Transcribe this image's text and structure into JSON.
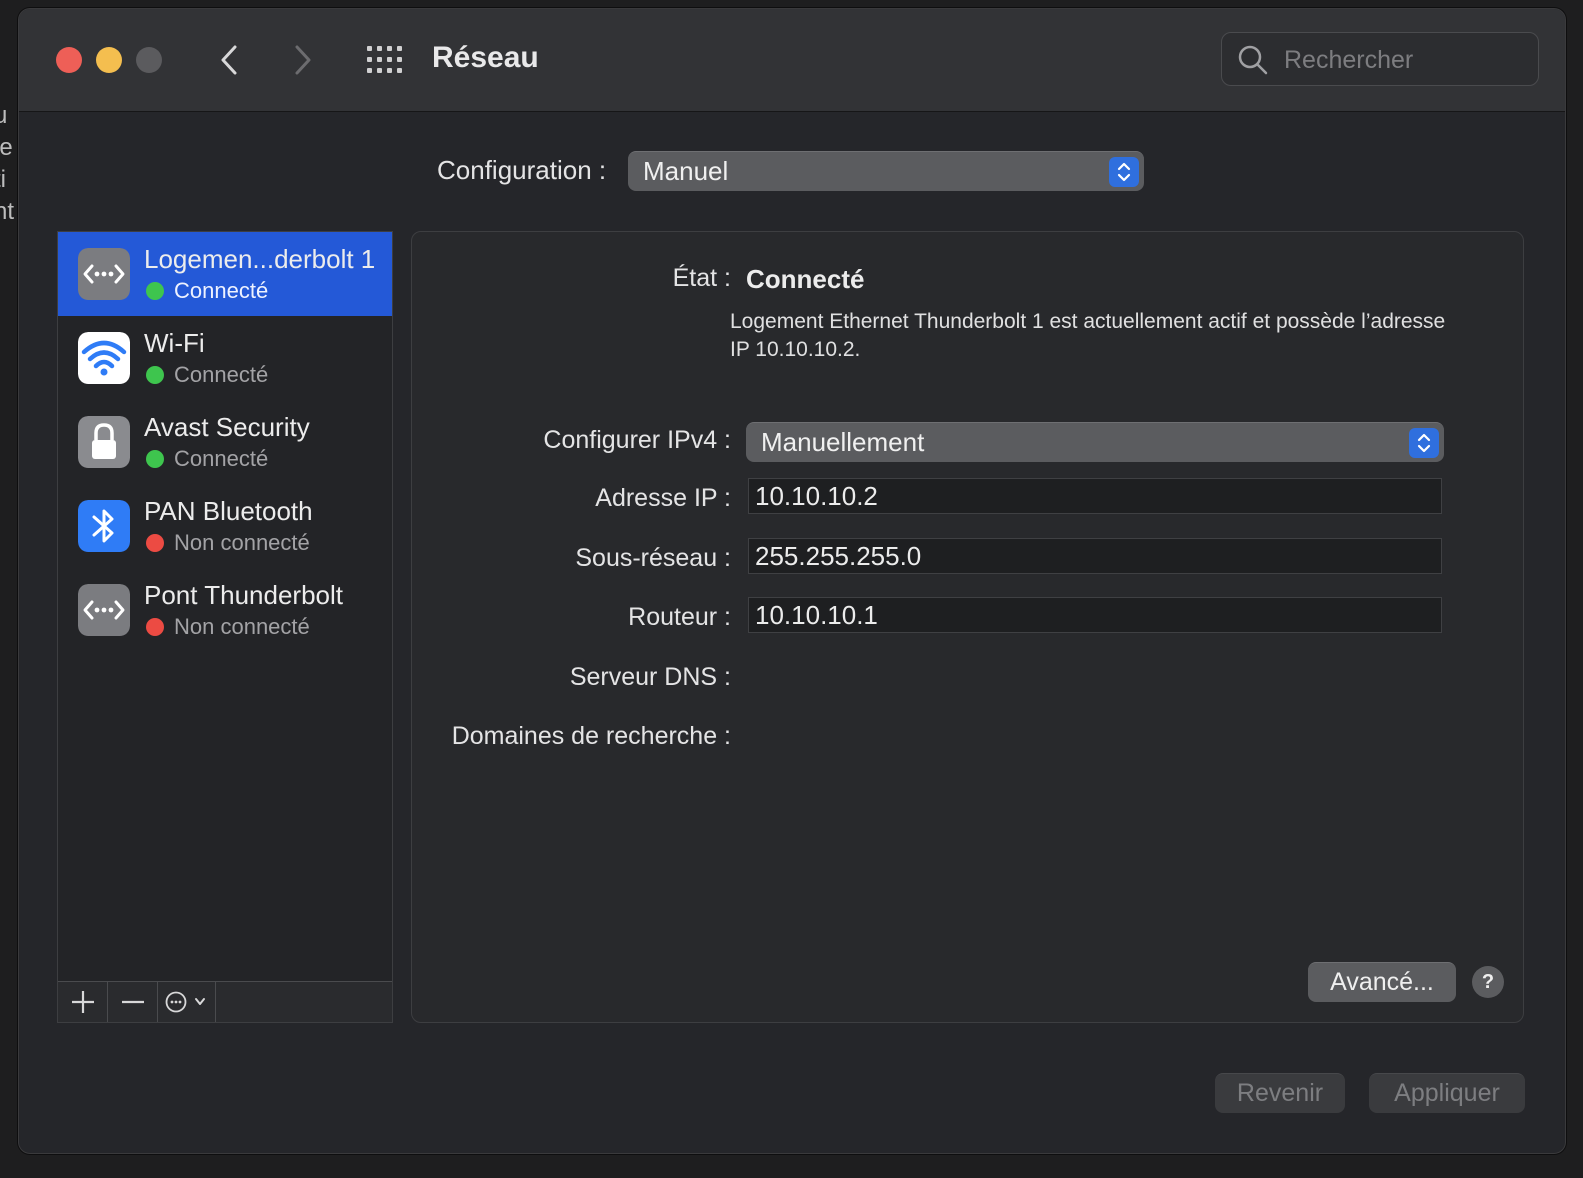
{
  "background_fragments": [
    "u",
    "le",
    "ti",
    "nt"
  ],
  "window": {
    "title": "Réseau",
    "search_placeholder": "Rechercher"
  },
  "configuration": {
    "label": "Configuration :",
    "value": "Manuel"
  },
  "services": [
    {
      "name": "Logemen...derbolt 1",
      "status": "Connecté",
      "status_color": "#3ec54e",
      "icon": "ethernet-icon",
      "selected": true
    },
    {
      "name": "Wi-Fi",
      "status": "Connecté",
      "status_color": "#3ec54e",
      "icon": "wifi-icon",
      "selected": false
    },
    {
      "name": "Avast Security",
      "status": "Connecté",
      "status_color": "#3ec54e",
      "icon": "lock-icon",
      "selected": false
    },
    {
      "name": "PAN Bluetooth",
      "status": "Non connecté",
      "status_color": "#ec4b43",
      "icon": "bluetooth-icon",
      "selected": false
    },
    {
      "name": "Pont Thunderbolt",
      "status": "Non connecté",
      "status_color": "#ec4b43",
      "icon": "thunderbolt-bridge-icon",
      "selected": false
    }
  ],
  "details": {
    "state_label": "État :",
    "state_value": "Connecté",
    "state_description": "Logement Ethernet Thunderbolt 1 est actuellement actif et possède l’adresse IP 10.10.10.2.",
    "ipv4_label": "Configurer IPv4 :",
    "ipv4_value": "Manuellement",
    "ip_label": "Adresse IP :",
    "ip_value": "10.10.10.2",
    "subnet_label": "Sous-réseau :",
    "subnet_value": "255.255.255.0",
    "router_label": "Routeur :",
    "router_value": "10.10.10.1",
    "dns_label": "Serveur DNS :",
    "search_domains_label": "Domaines de recherche :",
    "advanced_button": "Avancé...",
    "help_button": "?"
  },
  "footer": {
    "revert_button": "Revenir",
    "apply_button": "Appliquer"
  },
  "colors": {
    "accent": "#2459d7",
    "connected": "#3ec54e",
    "disconnected": "#ec4b43"
  }
}
